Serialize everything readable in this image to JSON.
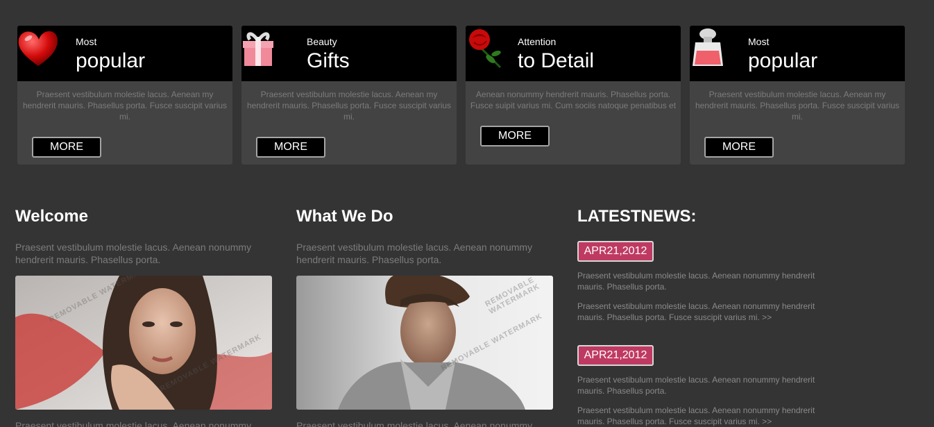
{
  "cards": [
    {
      "small": "Most",
      "big": "popular",
      "icon": "heart-icon",
      "text": "Praesent vestibulum molestie lacus. Aenean my hendrerit mauris. Phasellus porta. Fusce suscipit varius mi.",
      "button": "MORE"
    },
    {
      "small": "Beauty",
      "big": "Gifts",
      "icon": "gift-icon",
      "text": "Praesent vestibulum molestie lacus. Aenean my hendrerit mauris. Phasellus porta. Fusce suscipit varius mi.",
      "button": "MORE"
    },
    {
      "small": "Attention",
      "big": "to Detail",
      "icon": "rose-icon",
      "text": "Aenean nonummy hendrerit mauris. Phasellus porta. Fusce suipit varius mi. Cum sociis natoque penatibus et",
      "button": "MORE"
    },
    {
      "small": "Most",
      "big": "popular",
      "icon": "perfume-icon",
      "text": "Praesent vestibulum molestie lacus. Aenean my hendrerit mauris. Phasellus porta. Fusce suscipit varius mi.",
      "button": "MORE"
    }
  ],
  "welcome": {
    "title": "Welcome",
    "text": "Praesent vestibulum molestie lacus. Aenean nonummy hendrerit mauris. Phasellus porta.",
    "bottom_text": "Praesent vestibulum molestie lacus. Aenean nonummy"
  },
  "whatwedo": {
    "title": "What We Do",
    "text": "Praesent vestibulum molestie lacus. Aenean nonummy hendrerit mauris. Phasellus porta.",
    "bottom_text": "Praesent vestibulum molestie lacus. Aenean nonummy"
  },
  "news": {
    "title": "LATESTNEWS:",
    "items": [
      {
        "date": "APR21,2012",
        "text1": "Praesent vestibulum molestie lacus. Aenean nonummy hendrerit mauris. Phasellus porta.",
        "text2": "Praesent vestibulum molestie lacus. Aenean nonummy hendrerit mauris. Phasellus porta. Fusce suscipit varius mi. >>"
      },
      {
        "date": "APR21,2012",
        "text1": "Praesent vestibulum molestie lacus. Aenean nonummy hendrerit mauris. Phasellus porta.",
        "text2": "Praesent vestibulum molestie lacus. Aenean nonummy hendrerit mauris. Phasellus porta. Fusce suscipit varius mi. >>"
      }
    ]
  },
  "watermark_text": "REMOVABLE WATERMARK",
  "colors": {
    "accent": "#bf3a62",
    "background": "#343434",
    "card": "#434343"
  }
}
